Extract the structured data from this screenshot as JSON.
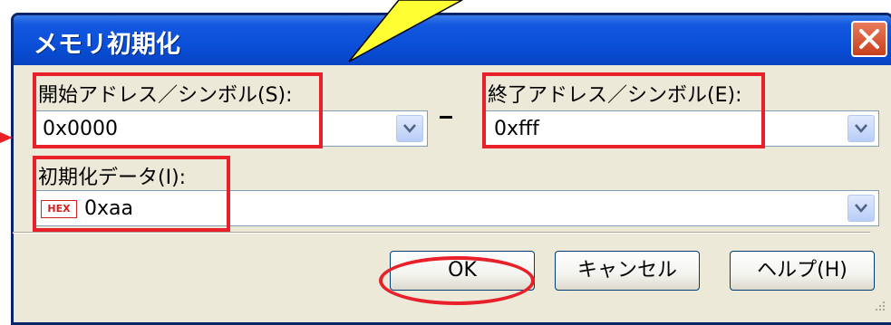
{
  "window": {
    "title": "メモリ初期化",
    "close_icon": "close-icon"
  },
  "fields": {
    "start_label": "開始アドレス／シンボル(S):",
    "start_value": "0x0000",
    "separator": "－",
    "end_label": "終了アドレス／シンボル(E):",
    "end_value": "0xfff",
    "init_label": "初期化データ(I):",
    "init_badge": "HEX",
    "init_value": "0xaa"
  },
  "buttons": {
    "ok": "OK",
    "cancel": "キャンセル",
    "help": "ヘルプ(H)"
  },
  "colors": {
    "titlebar": "#0a4fd8",
    "annotation_red": "#e8202a",
    "callout_yellow": "#ffff33"
  }
}
